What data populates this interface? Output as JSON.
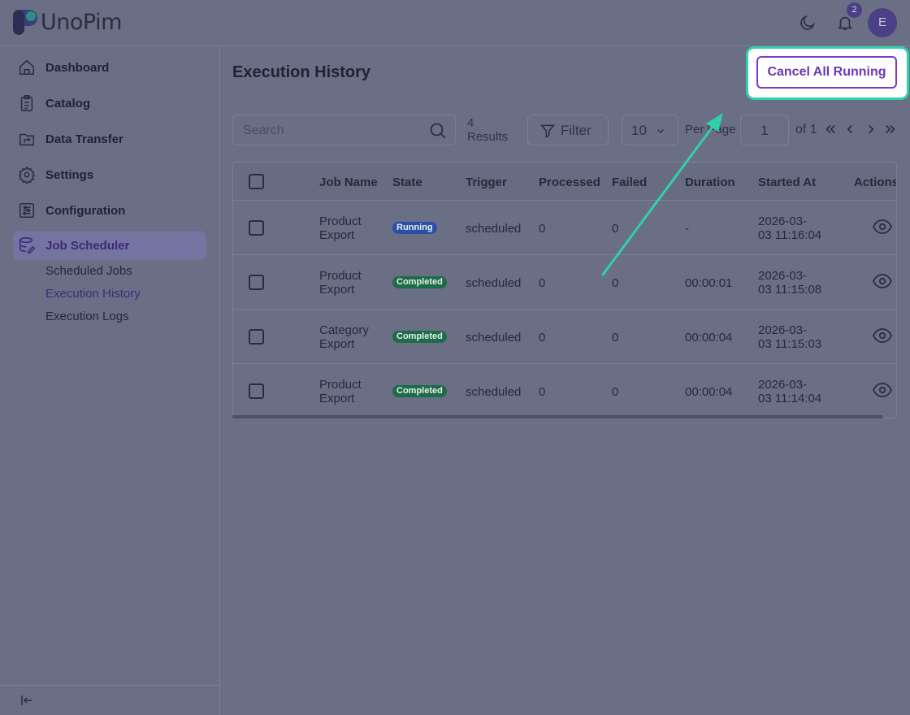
{
  "app": {
    "name": "UnoPim"
  },
  "header": {
    "notification_count": "2",
    "avatar_initial": "E"
  },
  "sidebar": {
    "items": [
      {
        "label": "Dashboard"
      },
      {
        "label": "Catalog"
      },
      {
        "label": "Data Transfer"
      },
      {
        "label": "Settings"
      },
      {
        "label": "Configuration"
      },
      {
        "label": "Job Scheduler"
      }
    ],
    "subitems": [
      {
        "label": "Scheduled Jobs"
      },
      {
        "label": "Execution History"
      },
      {
        "label": "Execution Logs"
      }
    ]
  },
  "page": {
    "title": "Execution History",
    "cancel_label": "Cancel All Running"
  },
  "toolbar": {
    "search_placeholder": "Search",
    "results_count": "4",
    "results_label": "Results",
    "filter_label": "Filter",
    "per_page_value": "10",
    "per_page_label": "Per Page",
    "page_value": "1",
    "of_label": "of 1"
  },
  "table": {
    "columns": [
      "Job Name",
      "State",
      "Trigger",
      "Processed",
      "Failed",
      "Duration",
      "Started At",
      "Actions"
    ],
    "rows": [
      {
        "job_line1": "Product",
        "job_line2": "Export",
        "state": "Running",
        "trigger": "scheduled",
        "processed": "0",
        "failed": "0",
        "duration": "-",
        "started_line1": "2026-03-",
        "started_line2": "03 11:16:04"
      },
      {
        "job_line1": "Product",
        "job_line2": "Export",
        "state": "Completed",
        "trigger": "scheduled",
        "processed": "0",
        "failed": "0",
        "duration": "00:00:01",
        "started_line1": "2026-03-",
        "started_line2": "03 11:15:08"
      },
      {
        "job_line1": "Category",
        "job_line2": "Export",
        "state": "Completed",
        "trigger": "scheduled",
        "processed": "0",
        "failed": "0",
        "duration": "00:00:04",
        "started_line1": "2026-03-",
        "started_line2": "03 11:15:03"
      },
      {
        "job_line1": "Product",
        "job_line2": "Export",
        "state": "Completed",
        "trigger": "scheduled",
        "processed": "0",
        "failed": "0",
        "duration": "00:00:04",
        "started_line1": "2026-03-",
        "started_line2": "03 11:14:04"
      }
    ]
  },
  "colors": {
    "accent": "#7c3bc7",
    "highlight": "#2fd2a8",
    "overlay": "#6b6f86"
  },
  "icons": [
    "logo-icon",
    "moon-icon",
    "bell-icon",
    "home-icon",
    "catalog-icon",
    "data-transfer-icon",
    "settings-icon",
    "configuration-icon",
    "job-scheduler-icon",
    "search-icon",
    "filter-icon",
    "chevron-down-icon",
    "eye-icon",
    "collapse-icon"
  ]
}
